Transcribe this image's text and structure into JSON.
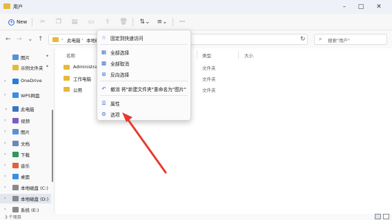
{
  "window": {
    "title": "用户"
  },
  "toolbar": {
    "new_label": "New"
  },
  "address": {
    "crumbs": [
      "此电脑",
      "本地磁盘"
    ],
    "separator": "›",
    "search_placeholder": "搜索\"用户\""
  },
  "sidebar": {
    "items": [
      {
        "label": "图片",
        "chevron": "",
        "pinned": true,
        "icon": "pictures-icon",
        "color": "#5b8fd6"
      },
      {
        "label": "示例文件夹",
        "chevron": "",
        "pinned": true,
        "icon": "folder-icon",
        "color": "#e8b83a"
      },
      {
        "label": "OneDrive",
        "chevron": "›",
        "pinned": false,
        "icon": "onedrive-icon",
        "color": "#2b7cd3"
      },
      {
        "label": "WPS网盘",
        "chevron": "›",
        "pinned": false,
        "icon": "wps-cloud-icon",
        "color": "#3a8fe0"
      },
      {
        "label": "此电脑",
        "chevron": "⌄",
        "pinned": false,
        "icon": "this-pc-icon",
        "color": "#3c74c4"
      },
      {
        "label": "视频",
        "chevron": "›",
        "pinned": false,
        "icon": "videos-icon",
        "color": "#7b5cc4"
      },
      {
        "label": "图片",
        "chevron": "›",
        "pinned": false,
        "icon": "pictures-icon",
        "color": "#5b8fd6"
      },
      {
        "label": "文档",
        "chevron": "›",
        "pinned": false,
        "icon": "documents-icon",
        "color": "#6a89b8"
      },
      {
        "label": "下载",
        "chevron": "›",
        "pinned": false,
        "icon": "downloads-icon",
        "color": "#2e9a58"
      },
      {
        "label": "音乐",
        "chevron": "›",
        "pinned": false,
        "icon": "music-icon",
        "color": "#e0623a"
      },
      {
        "label": "桌面",
        "chevron": "›",
        "pinned": false,
        "icon": "desktop-icon",
        "color": "#3a8fe0"
      },
      {
        "label": "本地磁盘 (C:)",
        "chevron": "›",
        "pinned": false,
        "icon": "drive-icon",
        "color": "#8a8a8a"
      },
      {
        "label": "本地磁盘 (D:)",
        "chevron": "›",
        "pinned": false,
        "icon": "drive-icon",
        "color": "#8a8a8a",
        "active": true
      },
      {
        "label": "系统 (E:)",
        "chevron": "›",
        "pinned": false,
        "icon": "drive-icon",
        "color": "#8a8a8a"
      }
    ]
  },
  "columns": {
    "name": "名称",
    "type": "类型",
    "size": "大小"
  },
  "files": [
    {
      "name": "Administrator",
      "type": "文件夹"
    },
    {
      "name": "工作电脑",
      "type": "文件夹"
    },
    {
      "name": "公用",
      "type": "文件夹"
    }
  ],
  "context_menu": {
    "items": [
      {
        "label": "固定到快速访问",
        "icon": "pin-icon",
        "glyph": "☆"
      },
      {
        "label": "全部选择",
        "icon": "select-all-icon",
        "glyph": "▦"
      },
      {
        "label": "全部取消",
        "icon": "select-none-icon",
        "glyph": "▩"
      },
      {
        "label": "反向选择",
        "icon": "invert-selection-icon",
        "glyph": "⊞"
      },
      {
        "label": "撤消 将\"新建文件夹\"重命名为\"图片\"",
        "icon": "undo-icon",
        "glyph": "↶"
      },
      {
        "label": "属性",
        "icon": "properties-icon",
        "glyph": "☰"
      },
      {
        "label": "选项",
        "icon": "options-icon",
        "glyph": "⚙"
      }
    ]
  },
  "status": {
    "text": "3 个项目"
  },
  "colors": {
    "accent": "#2a6ad0",
    "annotation_arrow": "#e8392f",
    "folder": "#e8b83a"
  }
}
